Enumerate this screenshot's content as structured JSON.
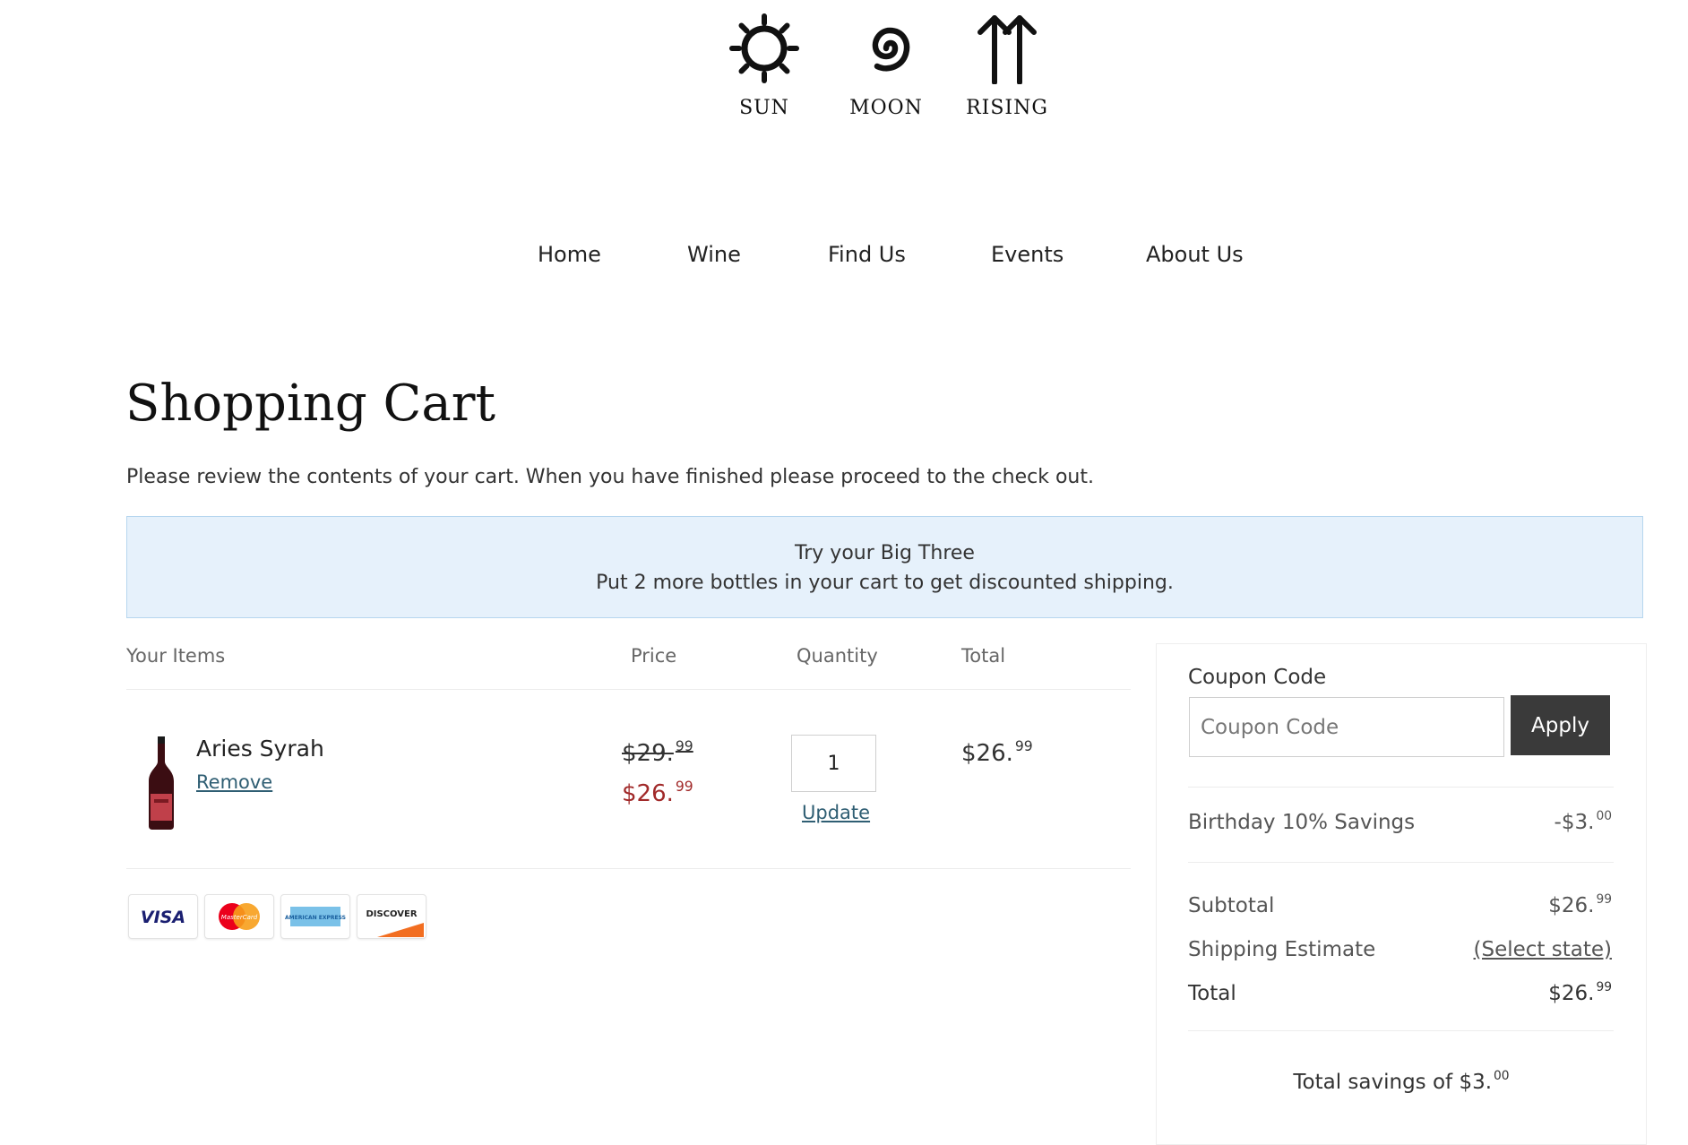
{
  "brand": {
    "sun_label": "SUN",
    "moon_label": "MOON",
    "rising_label": "RISING"
  },
  "nav": {
    "items": [
      "Home",
      "Wine",
      "Find Us",
      "Events",
      "About Us"
    ]
  },
  "page": {
    "title": "Shopping Cart",
    "intro": "Please review the contents of your cart. When you have finished please proceed to the check out."
  },
  "promo": {
    "line1": "Try your Big Three",
    "line2": "Put 2 more bottles in your cart to get discounted shipping."
  },
  "cart": {
    "headers": {
      "items": "Your Items",
      "price": "Price",
      "quantity": "Quantity",
      "total": "Total"
    },
    "item": {
      "name": "Aries Syrah",
      "remove_label": "Remove",
      "original_price_whole": "$29.",
      "original_price_cents": "99",
      "sale_price_whole": "$26.",
      "sale_price_cents": "99",
      "quantity": "1",
      "update_label": "Update",
      "total_whole": "$26.",
      "total_cents": "99"
    },
    "payment_cards": [
      "VISA",
      "MasterCard",
      "AMERICAN EXPRESS",
      "DISCOVER"
    ]
  },
  "summary": {
    "coupon_label": "Coupon Code",
    "coupon_placeholder": "Coupon Code",
    "apply_label": "Apply",
    "discount_label": "Birthday 10% Savings",
    "discount_whole": "-$3.",
    "discount_cents": "00",
    "subtotal_label": "Subtotal",
    "subtotal_whole": "$26.",
    "subtotal_cents": "99",
    "shipping_label": "Shipping Estimate",
    "shipping_link": "(Select state)",
    "total_label": "Total",
    "total_whole": "$26.",
    "total_cents": "99",
    "savings_text": "Total savings of $3.",
    "savings_cents": "00"
  },
  "colors": {
    "accent_dark": "#3a3a3a",
    "sale_red": "#a12a2a",
    "link_blue": "#2f5e73",
    "promo_bg": "#e6f1fb"
  }
}
